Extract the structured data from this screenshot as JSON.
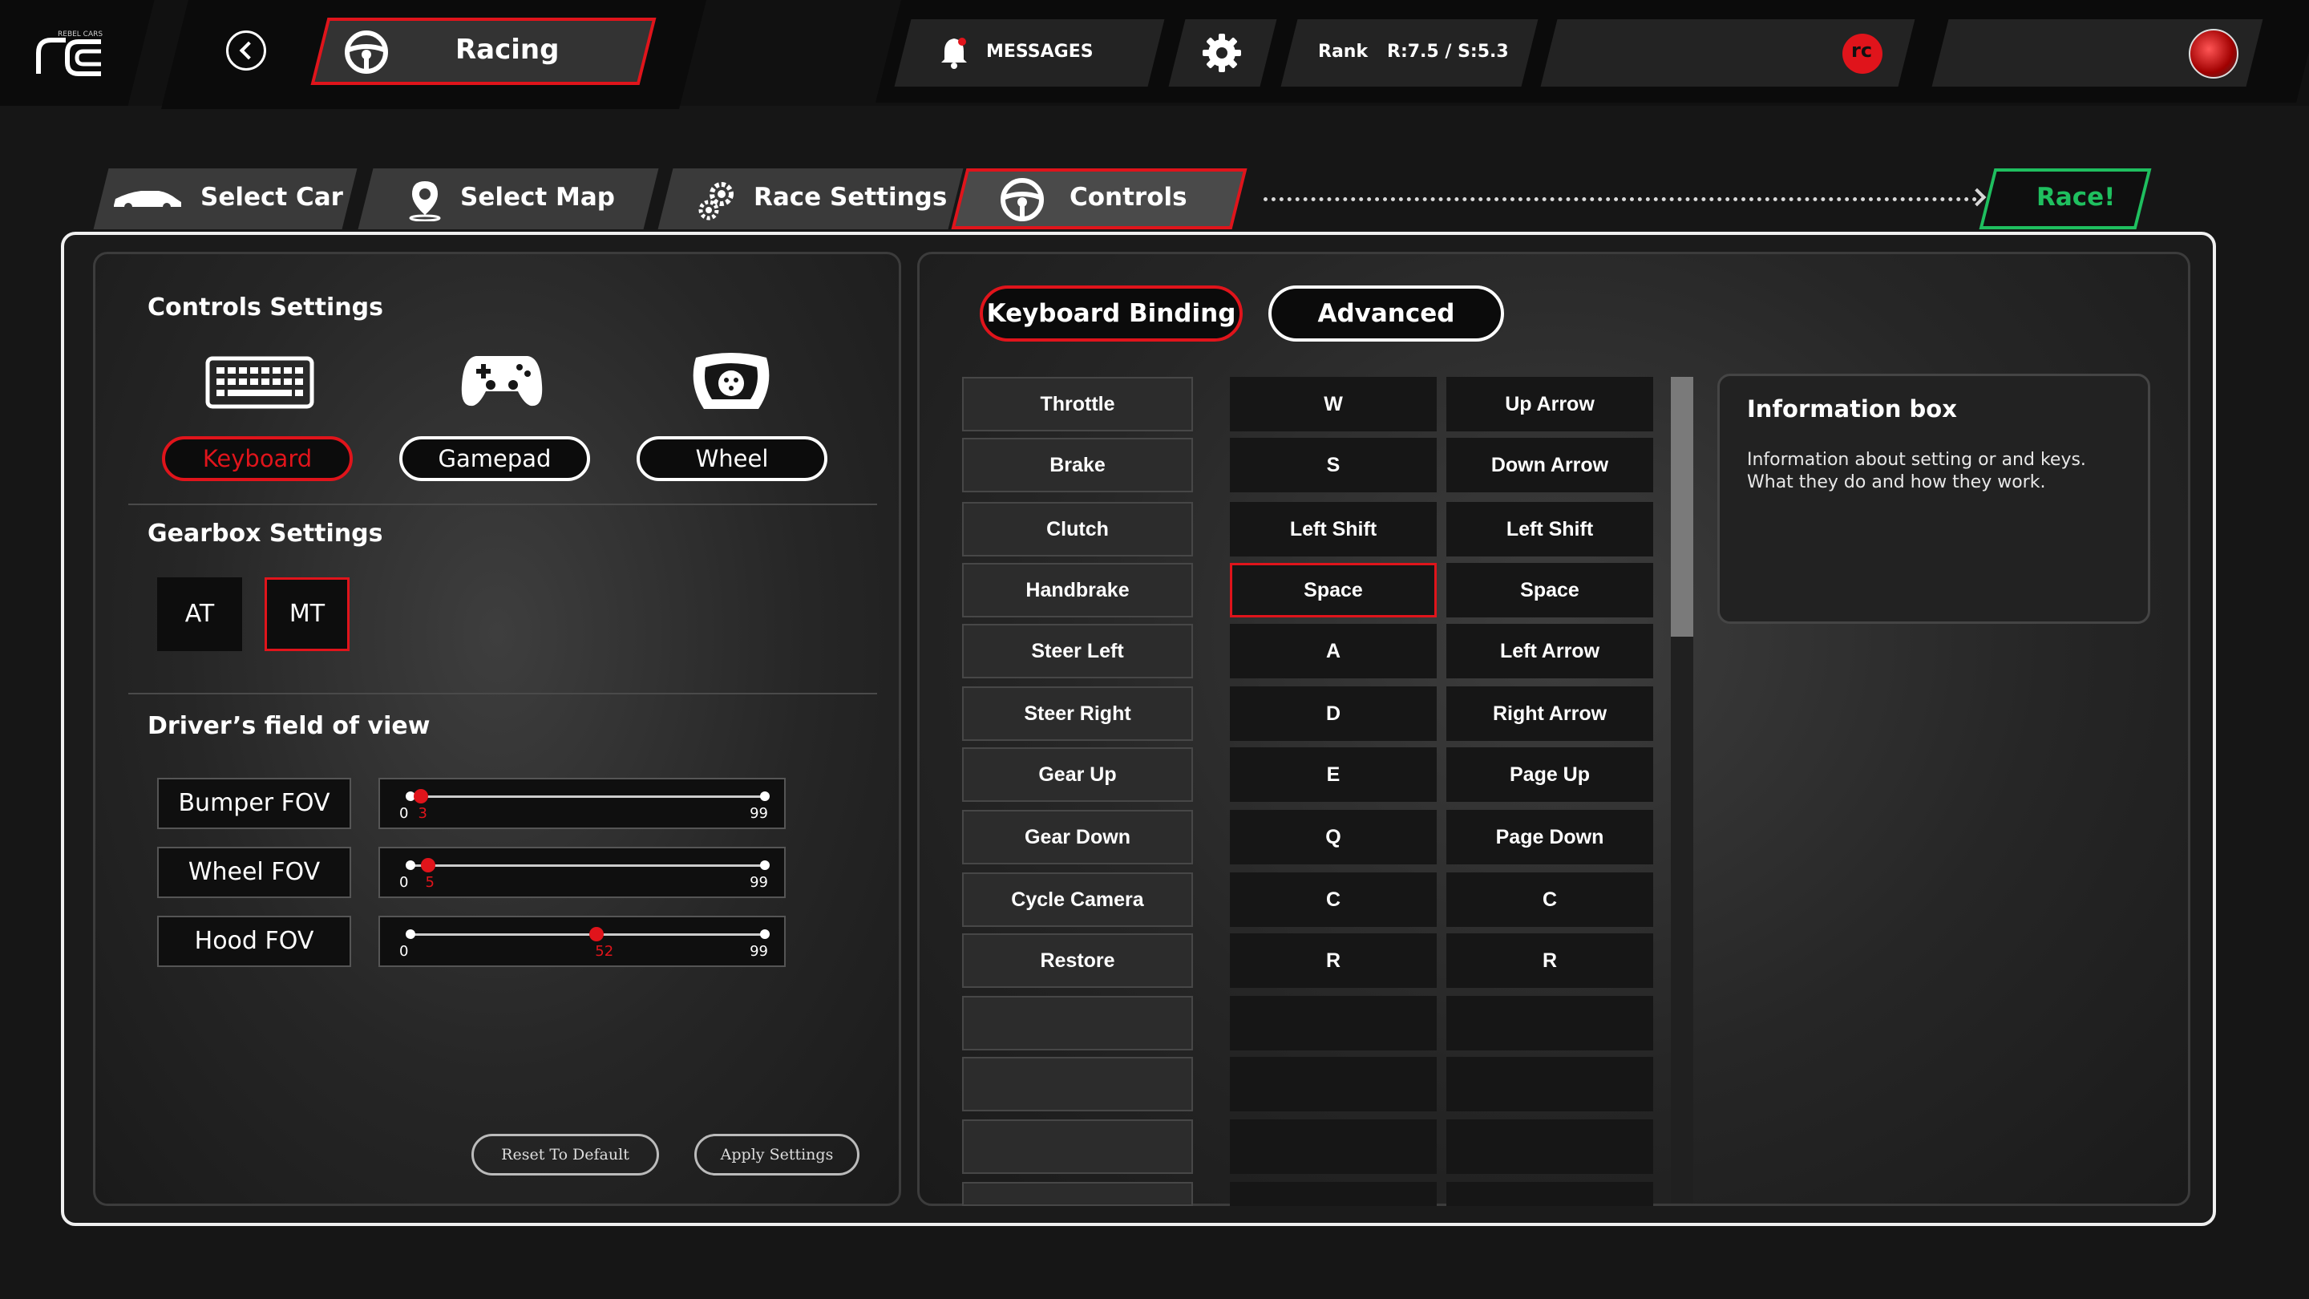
{
  "app": {
    "logo_text": "REBEL CARS",
    "logo_mark": "rc"
  },
  "header": {
    "mode_title": "Racing",
    "messages_label": "MESSAGES",
    "rank_label": "Rank",
    "rank_value": "R:7.5 / S:5.3"
  },
  "steps": [
    {
      "label": "Select Car",
      "icon": "car-icon"
    },
    {
      "label": "Select Map",
      "icon": "map-pin-icon"
    },
    {
      "label": "Race Settings",
      "icon": "gears-icon"
    },
    {
      "label": "Controls",
      "icon": "steering-wheel-icon"
    }
  ],
  "race_button": "Race!",
  "controls": {
    "title": "Controls Settings",
    "devices": [
      "Keyboard",
      "Gamepad",
      "Wheel"
    ],
    "active_device": "Keyboard",
    "gearbox_title": "Gearbox Settings",
    "gearbox_options": [
      "AT",
      "MT"
    ],
    "active_gearbox": "MT",
    "fov_title": "Driver’s field of view",
    "fov": [
      {
        "label": "Bumper FOV",
        "min": "0",
        "max": "99",
        "value": 3,
        "value_text": "3"
      },
      {
        "label": "Wheel FOV",
        "min": "0",
        "max": "99",
        "value": 5,
        "value_text": "5"
      },
      {
        "label": "Hood FOV",
        "min": "0",
        "max": "99",
        "value": 52,
        "value_text": "52"
      }
    ],
    "reset_button": "Reset To Default",
    "apply_button": "Apply Settings"
  },
  "binding": {
    "tabs": [
      "Keyboard Binding",
      "Advanced"
    ],
    "active_tab": "Keyboard Binding",
    "rows": [
      {
        "action": "Throttle",
        "primary": "W",
        "secondary": "Up Arrow"
      },
      {
        "action": "Brake",
        "primary": "S",
        "secondary": "Down Arrow"
      },
      {
        "action": "Clutch",
        "primary": "Left Shift",
        "secondary": "Left Shift"
      },
      {
        "action": "Handbrake",
        "primary": "Space",
        "secondary": "Space"
      },
      {
        "action": "Steer Left",
        "primary": "A",
        "secondary": "Left Arrow"
      },
      {
        "action": "Steer Right",
        "primary": "D",
        "secondary": "Right Arrow"
      },
      {
        "action": "Gear Up",
        "primary": "E",
        "secondary": "Page Up"
      },
      {
        "action": "Gear Down",
        "primary": "Q",
        "secondary": "Page Down"
      },
      {
        "action": "Cycle Camera",
        "primary": "C",
        "secondary": "C"
      },
      {
        "action": "Restore",
        "primary": "R",
        "secondary": "R"
      },
      {
        "action": "",
        "primary": "",
        "secondary": ""
      },
      {
        "action": "",
        "primary": "",
        "secondary": ""
      },
      {
        "action": "",
        "primary": "",
        "secondary": ""
      },
      {
        "action": "",
        "primary": "",
        "secondary": ""
      }
    ],
    "selected_row": 3
  },
  "info": {
    "title": "Information box",
    "line1": "Information about setting or and keys.",
    "line2": "What they do and how they work."
  },
  "colors": {
    "accent": "#e0141b",
    "race": "#1fbf5f",
    "background": "#161616"
  }
}
